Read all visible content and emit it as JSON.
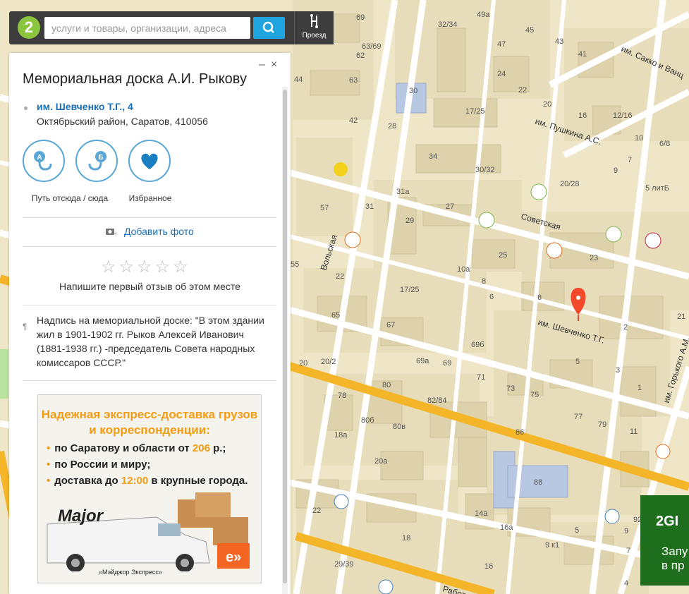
{
  "search": {
    "placeholder": "услуги и товары, организации, адреса",
    "logo_text": "2",
    "route_label": "Проезд"
  },
  "card": {
    "title": "Мемориальная доска А.И. Рыкову",
    "minimize_glyph": "–",
    "close_glyph": "×",
    "address_street": "им. Шевченко Т.Г., 4",
    "address_district": "Октябрьский район, Саратов, 410056",
    "actions": [
      {
        "label": "Путь отсюда / сюда",
        "icon": "route-icon"
      },
      {
        "label": "Избранное",
        "icon": "heart-icon"
      }
    ],
    "add_photo": "Добавить фото",
    "rating_stars": 0,
    "review_prompt": "Напишите первый отзыв об этом месте",
    "note": "Надпись на мемориальной доске: \"В этом здании жил в 1901-1902 гг. Рыков Алексей Иванович (1881-1938 гг.) -председатель Совета народных комиссаров СССР.\""
  },
  "ad": {
    "title_line1": "Надежная экспресс-доставка грузов",
    "title_line2": "и корреспонденции:",
    "line1_text": "по Саратову и области от ",
    "line1_hl": "206",
    "line1_tail": " р.;",
    "line2_text": "по России и миру;",
    "line3_text": "доставка до ",
    "line3_hl": "12:00",
    "line3_tail": " в крупные города.",
    "brand": "Major",
    "caption": "«Мэйджор Экспресс»"
  },
  "promo": {
    "logo": "2GI",
    "line1": "Запу",
    "line2": "в пр"
  },
  "map": {
    "colors": {
      "background": "#efe6c8",
      "block": "#e6dcb8",
      "building": "#ddd3ae",
      "main_road": "#f4b528",
      "street": "#ffffff",
      "marker": "#f2492a",
      "public_building": "#b8c7e0"
    },
    "streets": [
      {
        "name": "им. Сакко и Ванцетти"
      },
      {
        "name": "им. Пушкина А.С."
      },
      {
        "name": "Советская"
      },
      {
        "name": "им. Шевченко Т.Г."
      },
      {
        "name": "Вольская"
      },
      {
        "name": "им. Горького А.М."
      },
      {
        "name": "Работ"
      }
    ],
    "house_numbers": [
      "69",
      "49а",
      "32/34",
      "47",
      "45",
      "43",
      "41",
      "63",
      "63/69",
      "24",
      "22",
      "20",
      "16",
      "12/16",
      "10",
      "6/8",
      "62",
      "42",
      "30",
      "17/25",
      "28",
      "34",
      "30/32",
      "20/28",
      "9",
      "7",
      "5 литБ",
      "57",
      "31",
      "31а",
      "27",
      "29",
      "25",
      "23",
      "6",
      "10а",
      "8",
      "2",
      "17/25",
      "21",
      "44",
      "55",
      "22",
      "65",
      "67",
      "6",
      "69б",
      "69а",
      "69",
      "71",
      "5",
      "3",
      "73",
      "75",
      "77",
      "79",
      "1",
      "11",
      "20",
      "20/2",
      "80",
      "78",
      "82/84",
      "80б",
      "80в",
      "18а",
      "20а",
      "86",
      "88",
      "22",
      "14а",
      "16а",
      "18",
      "16",
      "9 к1",
      "5",
      "29/39",
      "92",
      "9",
      "7",
      "4"
    ],
    "marker": {
      "label": "Мемориальная доска А.И. Рыкову"
    }
  }
}
